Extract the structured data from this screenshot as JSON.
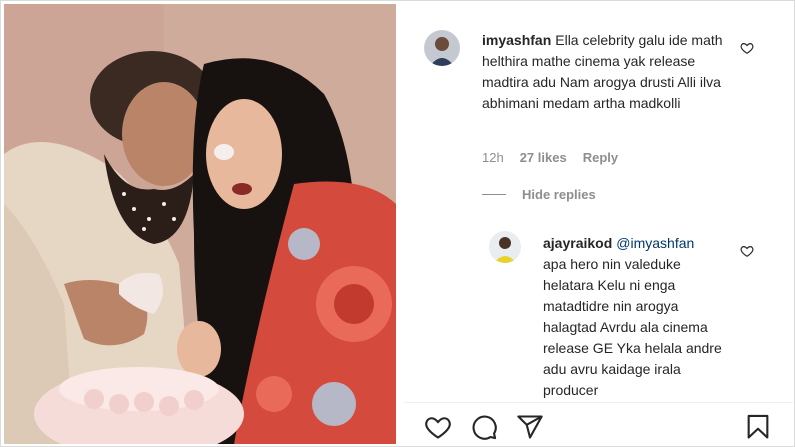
{
  "photo": {
    "alt_icon": "photo-couple-cake"
  },
  "comment_main": {
    "username": "imyashfan",
    "text": "Ella celebrity galu ide math helthira mathe cinema yak release madtira adu Nam arogya drusti Alli ilva abhimani medam artha madkolli",
    "time": "12h",
    "likes": "27 likes",
    "reply": "Reply",
    "icon": "heart-icon"
  },
  "hide_replies_label": "Hide replies",
  "comment_reply": {
    "username": "ajayraikod",
    "mention": "@imyashfan",
    "text": "apa hero nin valeduke helatara Kelu ni enga matadtidre nin arogya halagtad Avrdu ala cinema release GE Yka helala andre adu avru kaidage irala producer",
    "icon": "heart-icon"
  },
  "actions": {
    "like": "heart-icon",
    "comment": "comment-icon",
    "share": "share-icon",
    "save": "bookmark-icon"
  },
  "colors": {
    "text": "#262626",
    "meta": "#8e8e8e",
    "mention": "#00376b",
    "border": "#dbdbdb"
  }
}
